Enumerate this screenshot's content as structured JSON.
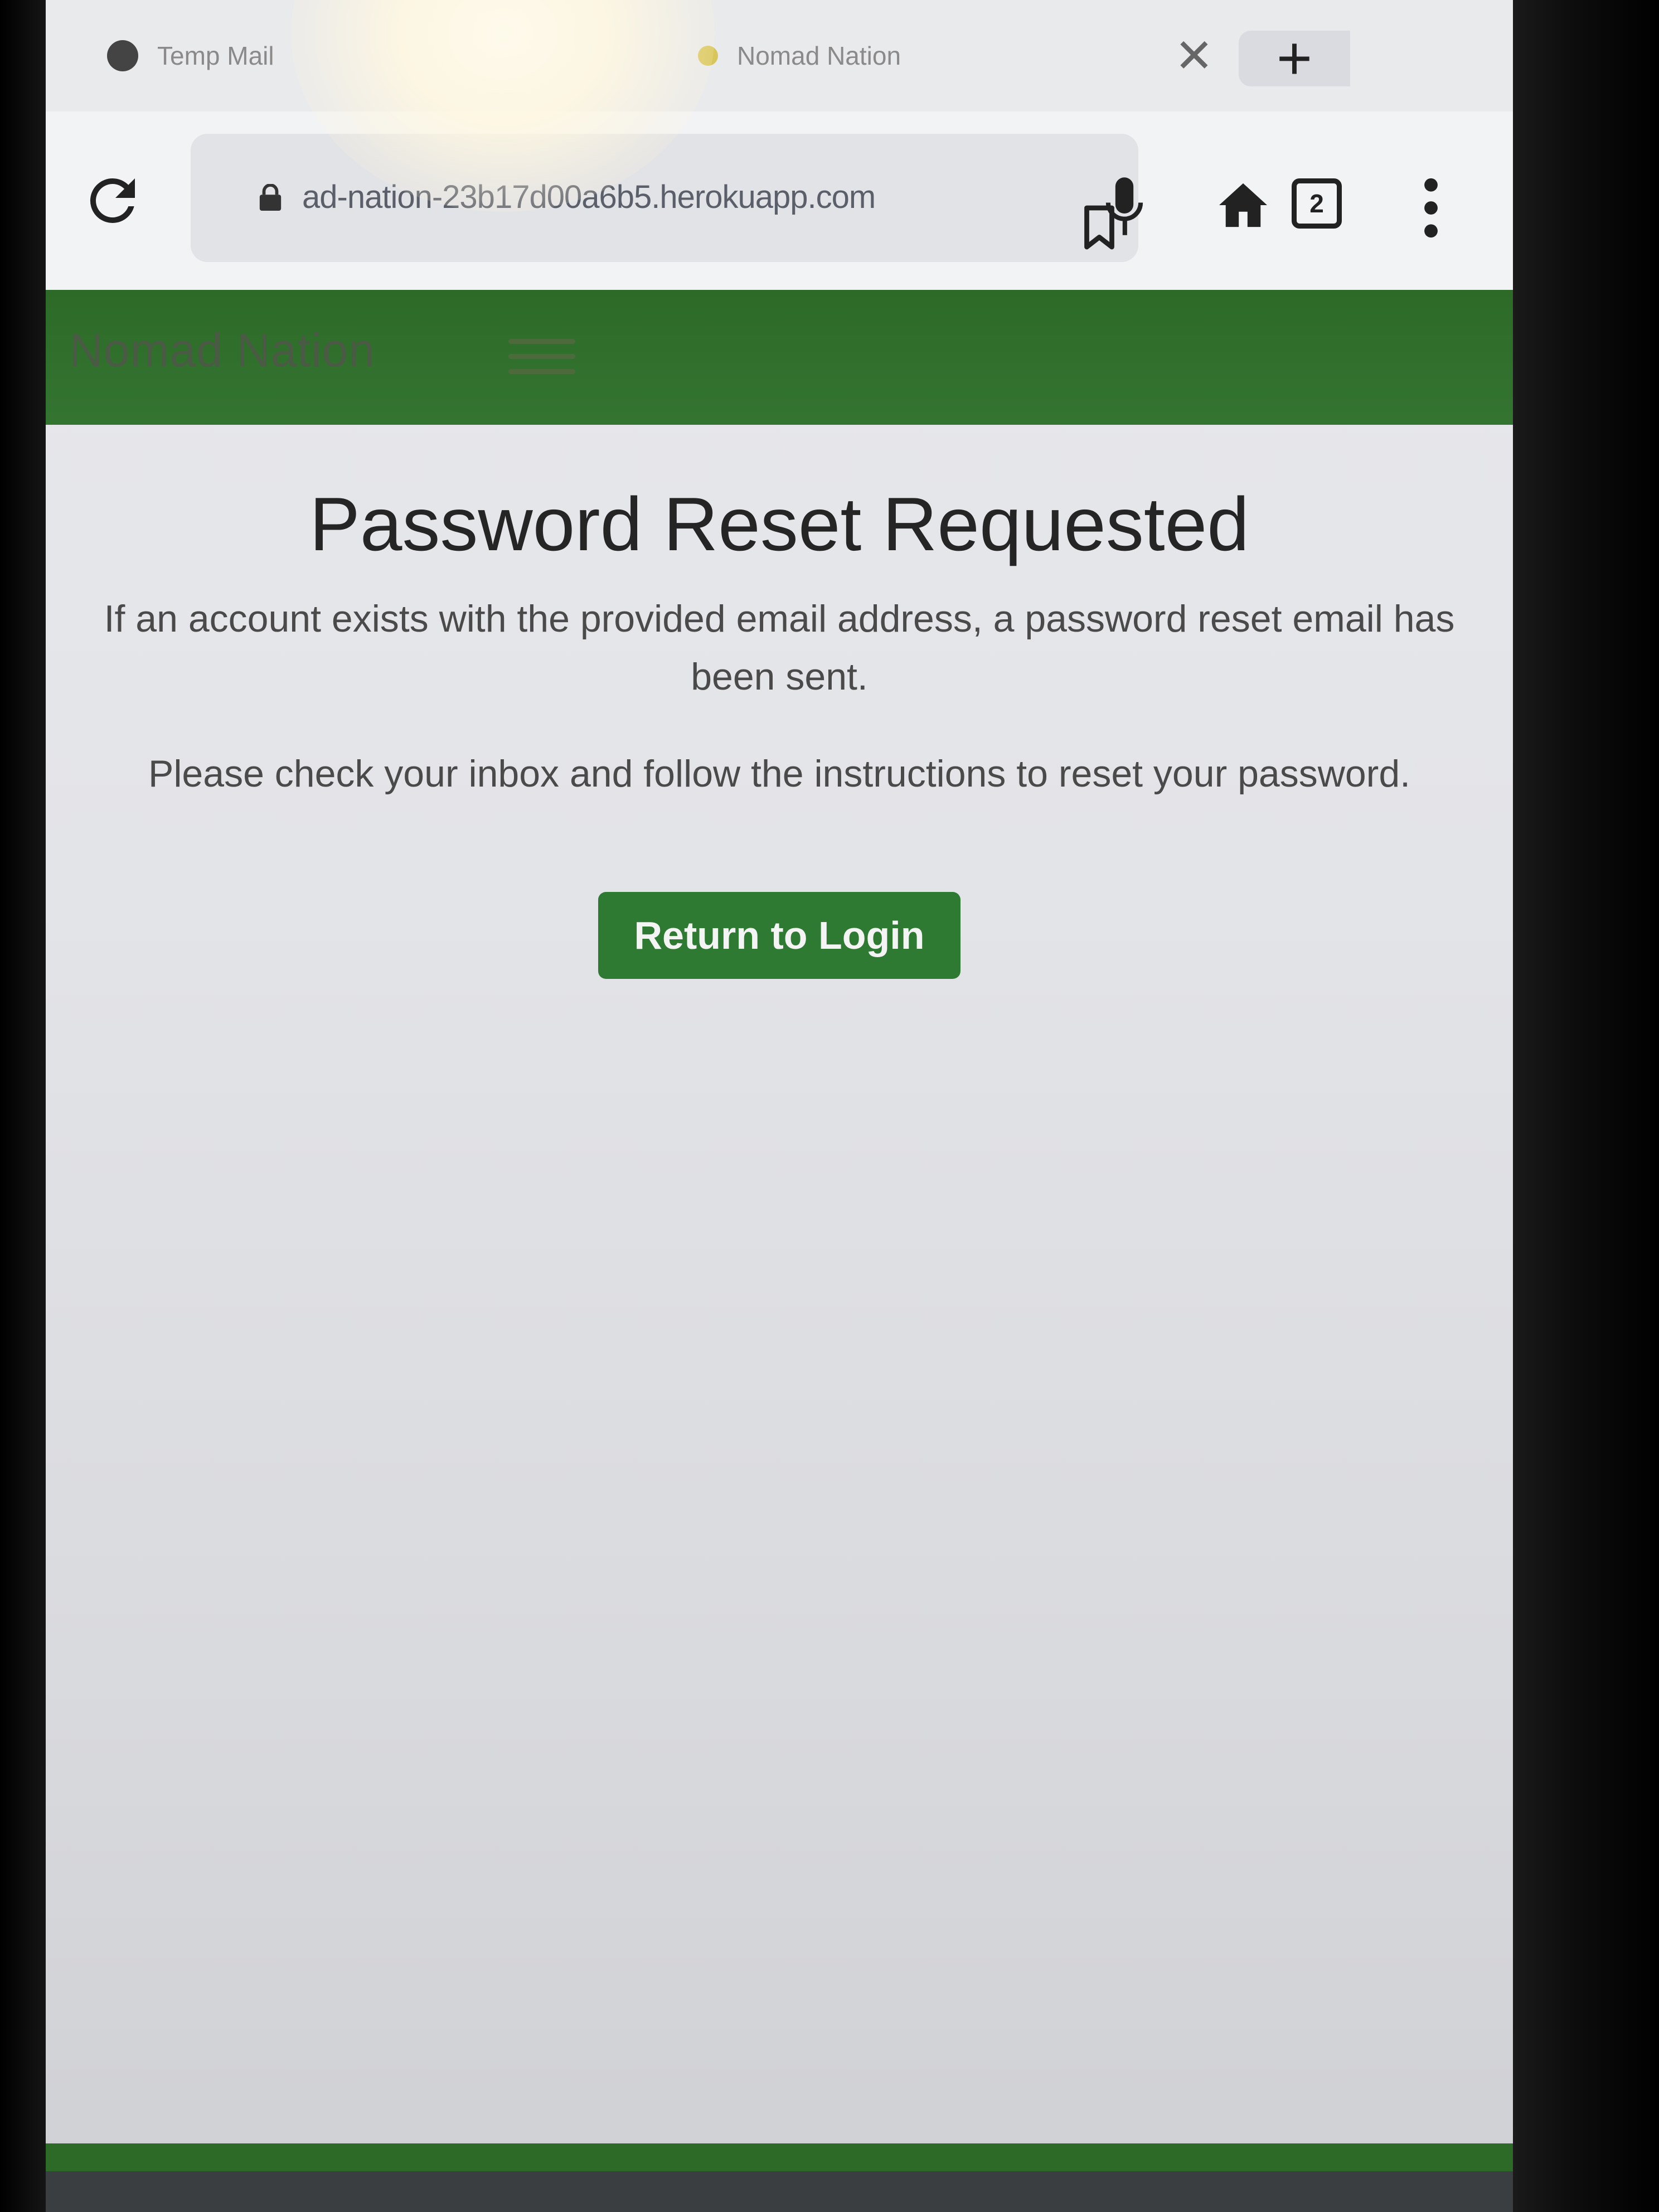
{
  "browser": {
    "tabs": [
      {
        "title": "Temp Mail",
        "favicon": "temp-mail-favicon"
      },
      {
        "title": "Nomad Nation",
        "favicon": "nomad-nation-favicon"
      }
    ],
    "close_tab_icon": "close-icon",
    "new_tab_icon": "plus-icon",
    "url": "ad-nation-23b17d00a6b5.herokuapp.com",
    "open_tabs_count": "2",
    "icons": {
      "reload": "reload-icon",
      "lock": "lock-icon",
      "bookmark": "bookmark-icon",
      "mic": "microphone-icon",
      "home": "home-icon",
      "tabs": "tab-switcher-icon",
      "menu": "more-vert-icon"
    }
  },
  "site": {
    "brand": "Nomad Nation",
    "menu_icon": "hamburger-menu-icon",
    "header_color": "#2f6b2b"
  },
  "main": {
    "title": "Password Reset Requested",
    "message_1": "If an account exists with the provided email address, a password reset email has been sent.",
    "message_2": "Please check your inbox and follow the instructions to reset your password.",
    "return_button_label": "Return to Login",
    "button_color": "#2f7a33"
  }
}
